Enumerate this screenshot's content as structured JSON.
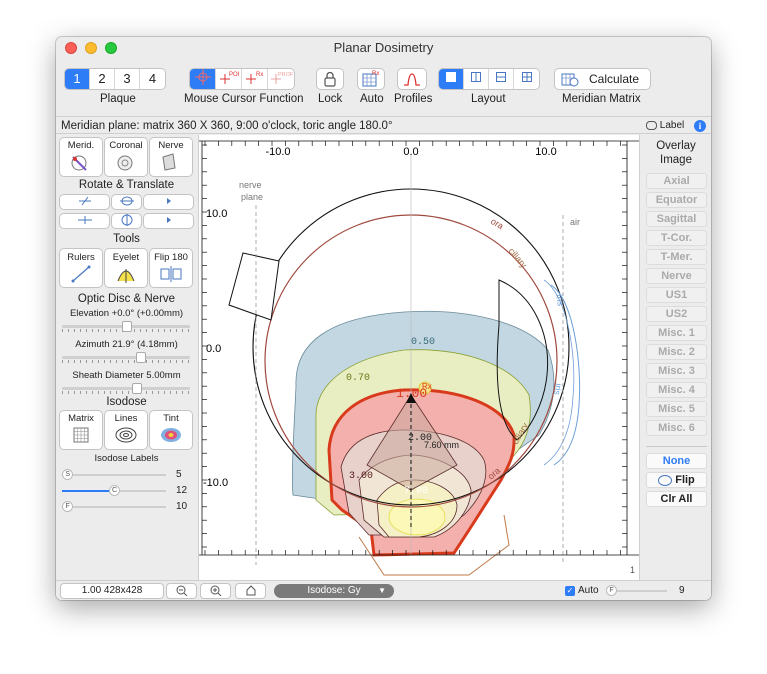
{
  "window": {
    "title": "Planar Dosimetry"
  },
  "toolbar": {
    "plaque": {
      "label": "Plaque",
      "items": [
        "1",
        "2",
        "3",
        "4"
      ],
      "selected": "1"
    },
    "mouse_cursor": {
      "label": "Mouse Cursor Function",
      "items": [
        "crosshair-icon",
        "poi-cursor-icon",
        "rx-cursor-icon",
        "prof-cursor-icon"
      ]
    },
    "lock": {
      "label": "Lock"
    },
    "auto": {
      "label": "Auto"
    },
    "profiles": {
      "label": "Profiles"
    },
    "layout": {
      "label": "Layout",
      "items": [
        "single-view-icon",
        "two-column-icon",
        "two-row-icon",
        "four-quadrant-icon"
      ]
    },
    "calculate": {
      "label": "Calculate"
    },
    "meridian_matrix": {
      "label": "Meridian Matrix"
    }
  },
  "infobar": {
    "text": "Meridian plane: matrix 360 X 360, 9:00 o'clock, toric angle 180.0°",
    "label_toggle": "Label"
  },
  "left_panel": {
    "view_buttons": [
      "Merid.",
      "Coronal",
      "Nerve"
    ],
    "rotate_translate": {
      "title": "Rotate & Translate"
    },
    "tools": {
      "title": "Tools",
      "buttons": [
        "Rulers",
        "Eyelet",
        "Flip 180"
      ]
    },
    "optic_disc": {
      "title": "Optic Disc & Nerve",
      "elevation": "Elevation +0.0° (+0.00mm)",
      "azimuth": "Azimuth 21.9° (4.18mm)",
      "sheath": "Sheath Diameter 5.00mm",
      "elevation_value": 0.5,
      "azimuth_value": 0.62,
      "sheath_value": 0.58
    },
    "isodose": {
      "title": "Isodose",
      "buttons": [
        "Matrix",
        "Lines",
        "Tint"
      ],
      "labels_title": "Isodose Labels",
      "sliders": [
        {
          "knob": "S",
          "value": "5",
          "fraction": 0.05
        },
        {
          "knob": "C",
          "value": "12",
          "fraction": 0.5
        },
        {
          "knob": "F",
          "value": "10",
          "fraction": 0.05
        }
      ]
    }
  },
  "plot": {
    "x_ticks": [
      "-10.0",
      "0.0",
      "10.0"
    ],
    "y_ticks": [
      "10.0",
      "0.0",
      "-10.0"
    ],
    "annotations": {
      "nerve": "nerve",
      "plane": "plane",
      "air": "air",
      "ora": "ora",
      "ciliary": "ciliary",
      "iris": "iris",
      "iris2": "iris",
      "ciliary2": "ciliary",
      "ora2": "ora",
      "rx": "Rx",
      "distance": "7.60 mm",
      "corner": "1"
    },
    "isodose_labels": [
      "0.50",
      "0.70",
      "1.00",
      "2.00",
      "3.00",
      "7.00"
    ],
    "colors": {
      "iso050": "#b7cfdc",
      "iso070": "#e6ecb8",
      "iso100": "#f0a8a8",
      "iso100_line": "#d93a1c",
      "sclera": "#a04a3e",
      "lens": "#6f9fd8"
    }
  },
  "right_panel": {
    "title1": "Overlay",
    "title2": "Image",
    "overlays": [
      "Axial",
      "Equator",
      "Sagittal",
      "T-Cor.",
      "T-Mer.",
      "Nerve",
      "US1",
      "US2",
      "Misc. 1",
      "Misc. 2",
      "Misc. 3",
      "Misc. 4",
      "Misc. 5",
      "Misc. 6"
    ],
    "none": "None",
    "flip": "Flip",
    "clear_all": "Clr All"
  },
  "bottombar": {
    "zoom": "1.00 428x428",
    "isodose_select": "Isodose: Gy",
    "auto": "Auto",
    "knob": "F",
    "value": "9"
  }
}
